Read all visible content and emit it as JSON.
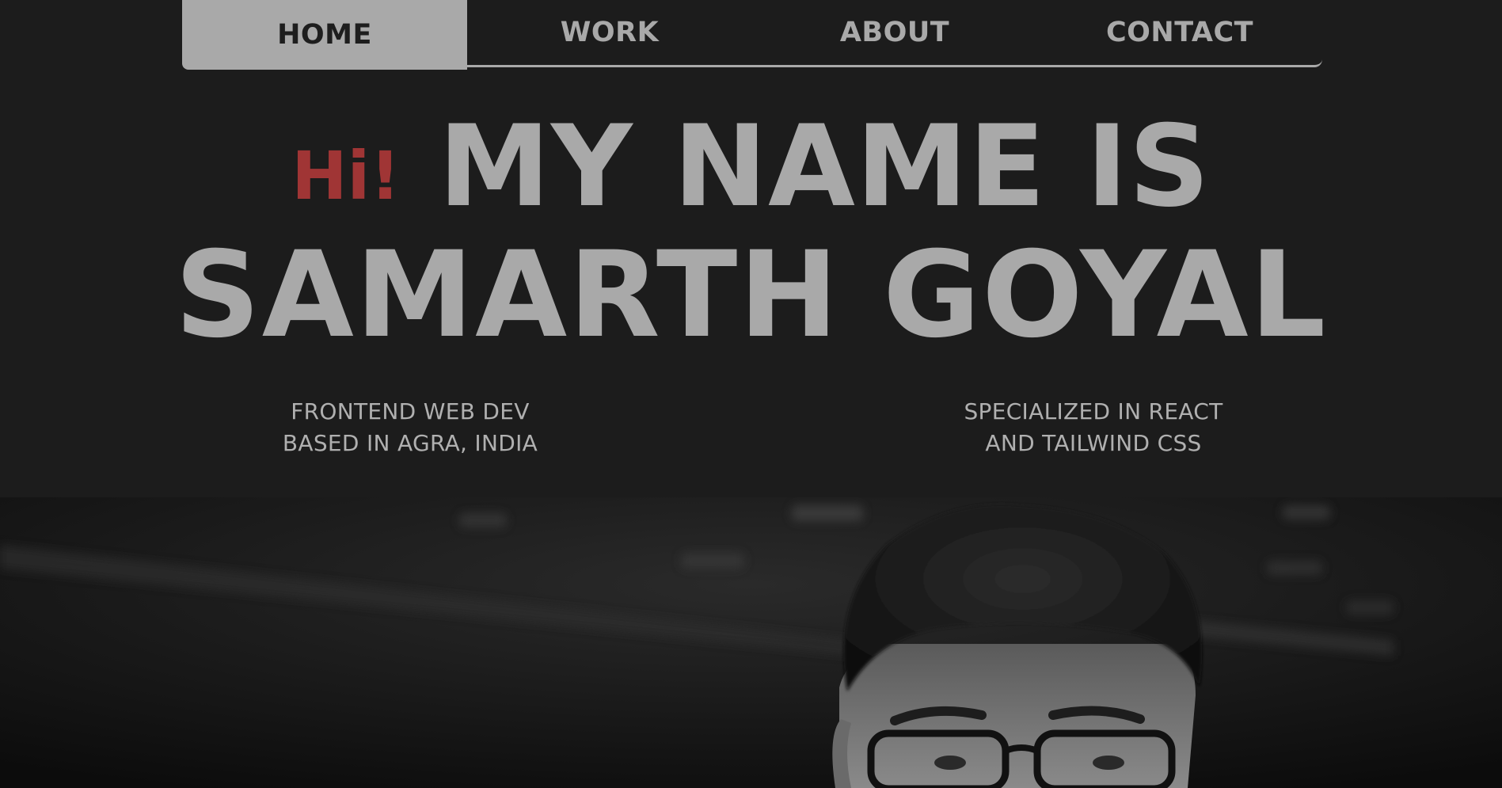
{
  "nav": {
    "items": [
      {
        "label": "HOME",
        "active": true
      },
      {
        "label": "WORK",
        "active": false
      },
      {
        "label": "ABOUT",
        "active": false
      },
      {
        "label": "CONTACT",
        "active": false
      }
    ]
  },
  "hero": {
    "greeting": "Hi!",
    "line1": "MY NAME IS",
    "line2": "SAMARTH GOYAL"
  },
  "info": {
    "left": {
      "line1": "FRONTEND WEB DEV",
      "line2": "BASED IN AGRA, INDIA"
    },
    "right": {
      "line1": "SPECIALIZED IN REACT",
      "line2": "AND TAILWIND CSS"
    }
  },
  "colors": {
    "background": "#1c1c1c",
    "text": "#a9a9a9",
    "accent": "#a03535"
  }
}
